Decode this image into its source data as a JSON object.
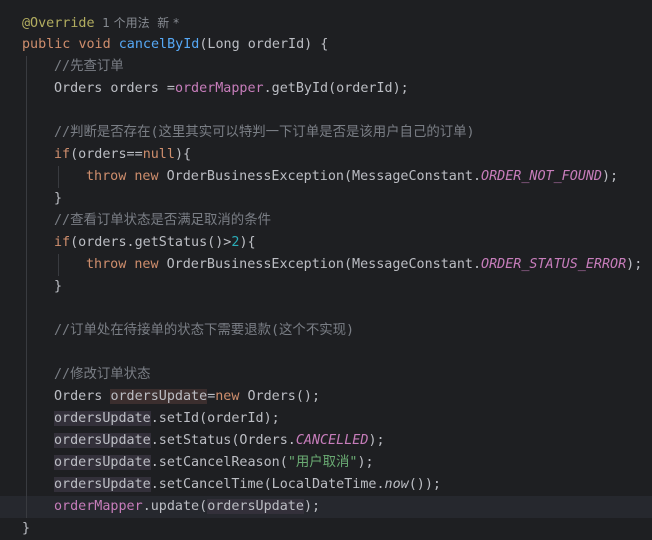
{
  "editor": {
    "lines": [
      {
        "indent": 0,
        "tokens": [
          {
            "t": "@Override",
            "c": "ann"
          },
          {
            "t": "  1 个用法  新 *",
            "c": "hint"
          }
        ]
      },
      {
        "indent": 0,
        "tokens": [
          {
            "t": "public",
            "c": "kw"
          },
          {
            "t": " "
          },
          {
            "t": "void",
            "c": "kw"
          },
          {
            "t": " "
          },
          {
            "t": "cancelById",
            "c": "fn"
          },
          {
            "t": "(Long orderId) {"
          }
        ]
      },
      {
        "indent": 1,
        "tokens": [
          {
            "t": "//先查订单",
            "c": "cmt"
          }
        ]
      },
      {
        "indent": 1,
        "tokens": [
          {
            "t": "Orders orders ="
          },
          {
            "t": "orderMapper",
            "c": "fld"
          },
          {
            "t": ".getById(orderId);"
          }
        ]
      },
      {
        "indent": 0,
        "tokens": []
      },
      {
        "indent": 1,
        "tokens": [
          {
            "t": "//判断是否存在(这里其实可以特判一下订单是否是该用户自己的订单)",
            "c": "cmt"
          }
        ]
      },
      {
        "indent": 1,
        "tokens": [
          {
            "t": "if",
            "c": "kw"
          },
          {
            "t": "(orders=="
          },
          {
            "t": "null",
            "c": "kw"
          },
          {
            "t": "){"
          }
        ]
      },
      {
        "indent": 2,
        "tokens": [
          {
            "t": "throw",
            "c": "kw"
          },
          {
            "t": " "
          },
          {
            "t": "new",
            "c": "kw"
          },
          {
            "t": " OrderBusinessException(MessageConstant."
          },
          {
            "t": "ORDER_NOT_FOUND",
            "c": "cst"
          },
          {
            "t": ");"
          }
        ]
      },
      {
        "indent": 1,
        "tokens": [
          {
            "t": "}"
          }
        ]
      },
      {
        "indent": 1,
        "tokens": [
          {
            "t": "//查看订单状态是否满足取消的条件",
            "c": "cmt"
          }
        ]
      },
      {
        "indent": 1,
        "tokens": [
          {
            "t": "if",
            "c": "kw"
          },
          {
            "t": "(orders.getStatus()>"
          },
          {
            "t": "2",
            "c": "num"
          },
          {
            "t": "){"
          }
        ]
      },
      {
        "indent": 2,
        "tokens": [
          {
            "t": "throw",
            "c": "kw"
          },
          {
            "t": " "
          },
          {
            "t": "new",
            "c": "kw"
          },
          {
            "t": " OrderBusinessException(MessageConstant."
          },
          {
            "t": "ORDER_STATUS_ERROR",
            "c": "cst"
          },
          {
            "t": ");"
          }
        ]
      },
      {
        "indent": 1,
        "tokens": [
          {
            "t": "}"
          }
        ]
      },
      {
        "indent": 0,
        "tokens": []
      },
      {
        "indent": 1,
        "tokens": [
          {
            "t": "//订单处在待接单的状态下需要退款(这个不实现)",
            "c": "cmt"
          }
        ]
      },
      {
        "indent": 0,
        "tokens": []
      },
      {
        "indent": 1,
        "tokens": [
          {
            "t": "//修改订单状态",
            "c": "cmt"
          }
        ]
      },
      {
        "indent": 1,
        "tokens": [
          {
            "t": "Orders "
          },
          {
            "t": "ordersUpdate",
            "c": "hl-def"
          },
          {
            "t": "="
          },
          {
            "t": "new",
            "c": "kw"
          },
          {
            "t": " Orders();"
          }
        ]
      },
      {
        "indent": 1,
        "tokens": [
          {
            "t": "ordersUpdate",
            "c": "hl-var"
          },
          {
            "t": ".setId(orderId);"
          }
        ]
      },
      {
        "indent": 1,
        "tokens": [
          {
            "t": "ordersUpdate",
            "c": "hl-var"
          },
          {
            "t": ".setStatus(Orders."
          },
          {
            "t": "CANCELLED",
            "c": "cst"
          },
          {
            "t": ");"
          }
        ]
      },
      {
        "indent": 1,
        "tokens": [
          {
            "t": "ordersUpdate",
            "c": "hl-var"
          },
          {
            "t": ".setCancelReason("
          },
          {
            "t": "\"用户取消\"",
            "c": "str"
          },
          {
            "t": ");"
          }
        ]
      },
      {
        "indent": 1,
        "tokens": [
          {
            "t": "ordersUpdate",
            "c": "hl-var"
          },
          {
            "t": ".setCancelTime(LocalDateTime."
          },
          {
            "t": "now",
            "c": "stt"
          },
          {
            "t": "());"
          }
        ]
      },
      {
        "indent": 1,
        "current": true,
        "tokens": [
          {
            "t": "orderMapper",
            "c": "fld"
          },
          {
            "t": ".update("
          },
          {
            "t": "ordersUpdate",
            "c": "hl-var"
          },
          {
            "t": ");"
          }
        ]
      },
      {
        "indent": 0,
        "tokens": [
          {
            "t": "}"
          }
        ]
      }
    ]
  }
}
